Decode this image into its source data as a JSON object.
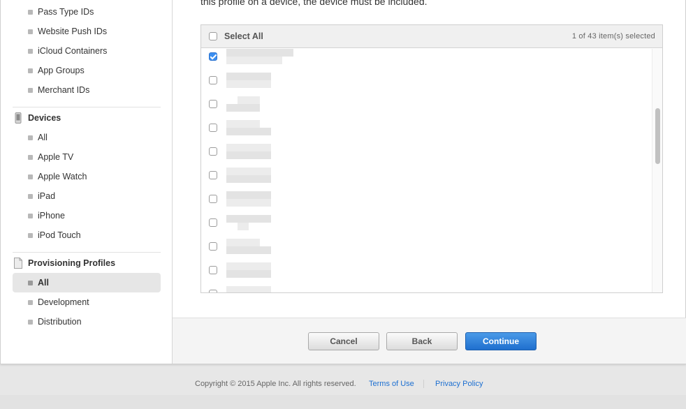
{
  "sidebar": {
    "identifier_items": [
      "Pass Type IDs",
      "Website Push IDs",
      "iCloud Containers",
      "App Groups",
      "Merchant IDs"
    ],
    "devices": {
      "title": "Devices",
      "icon": "phone-icon",
      "items": [
        "All",
        "Apple TV",
        "Apple Watch",
        "iPad",
        "iPhone",
        "iPod Touch"
      ]
    },
    "profiles": {
      "title": "Provisioning Profiles",
      "icon": "document-icon",
      "items": [
        "All",
        "Development",
        "Distribution"
      ],
      "active": "All"
    }
  },
  "main": {
    "instruction": "this profile on a device, the device must be included.",
    "list": {
      "select_all_label": "Select All",
      "selected_count": "1 of 43 item(s) selected",
      "rows_checked": [
        true,
        false,
        false,
        false,
        false,
        false,
        false,
        false,
        false,
        false,
        false
      ]
    }
  },
  "buttons": {
    "cancel": "Cancel",
    "back": "Back",
    "continue": "Continue"
  },
  "footer": {
    "copyright": "Copyright © 2015 Apple Inc. All rights reserved.",
    "terms": "Terms of Use",
    "privacy": "Privacy Policy"
  },
  "colors": {
    "accent": "#1c6fd1",
    "primary_button": "#2f80dc",
    "checkbox_checked": "#3b8ef0"
  }
}
